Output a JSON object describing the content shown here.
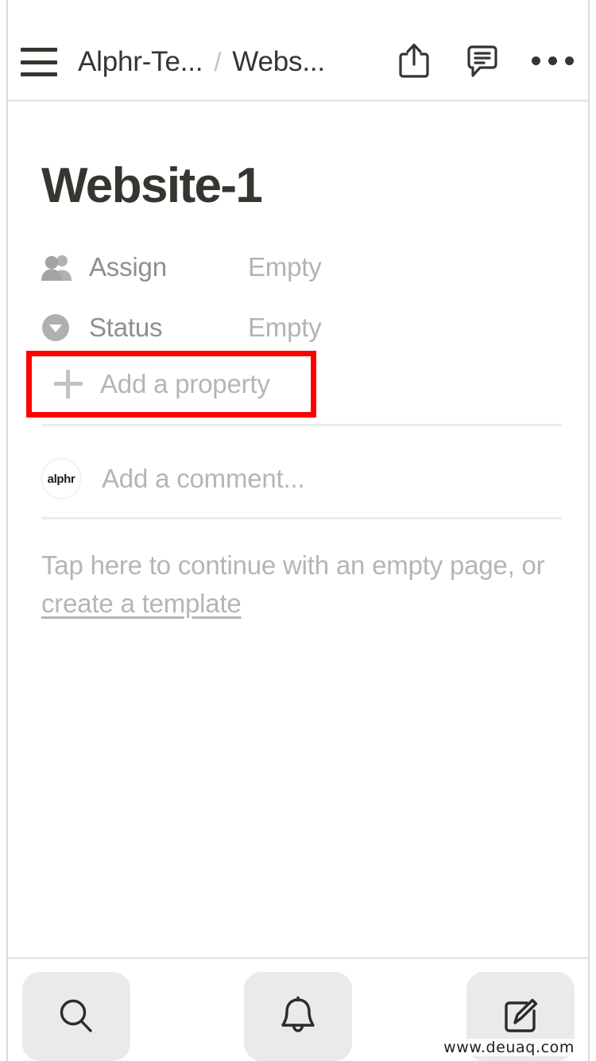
{
  "header": {
    "menu_icon": "hamburger-menu-icon",
    "breadcrumb": {
      "parent": "Alphr-Te...",
      "separator": "/",
      "current": "Webs..."
    },
    "actions": [
      {
        "name": "share-icon",
        "label": "Share"
      },
      {
        "name": "comment-icon",
        "label": "Comments"
      },
      {
        "name": "more-options-icon",
        "label": "More"
      }
    ]
  },
  "page": {
    "title": "Website-1",
    "properties": [
      {
        "icon": "people-icon",
        "label": "Assign",
        "value": "Empty"
      },
      {
        "icon": "status-chevron-icon",
        "label": "Status",
        "value": "Empty"
      }
    ],
    "add_property": {
      "icon": "plus-icon",
      "label": "Add a property",
      "highlighted": true,
      "highlight_color": "#ff0000"
    },
    "comment": {
      "avatar_text": "alphr",
      "placeholder": "Add a comment..."
    },
    "empty_prompt": {
      "text": "Tap here to continue with an empty page, or ",
      "link": "create a template"
    }
  },
  "bottom_bar": {
    "tabs": [
      {
        "name": "search-tab",
        "icon": "search-icon",
        "label": "Search"
      },
      {
        "name": "updates-tab",
        "icon": "bell-icon",
        "label": "Updates"
      },
      {
        "name": "compose-tab",
        "icon": "compose-icon",
        "label": "New page"
      }
    ]
  },
  "watermark": "www.deuaq.com"
}
